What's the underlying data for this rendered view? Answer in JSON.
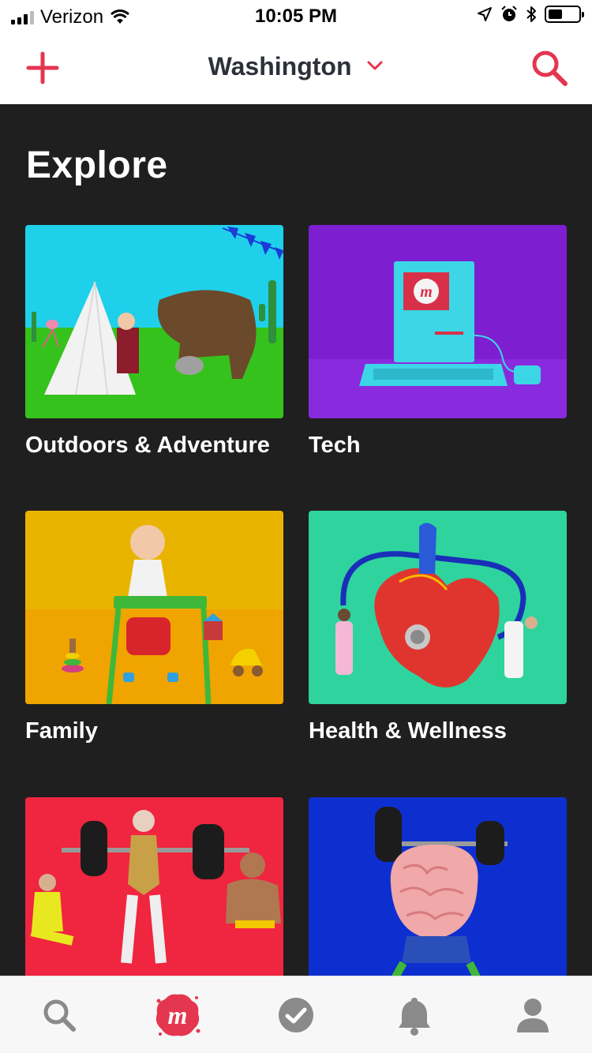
{
  "status_bar": {
    "carrier": "Verizon",
    "time": "10:05 PM"
  },
  "nav": {
    "location": "Washington",
    "accent_color": "#e5364f"
  },
  "explore": {
    "title": "Explore",
    "categories": [
      {
        "label": "Outdoors & Adventure",
        "bg_color": "#1fd0ea"
      },
      {
        "label": "Tech",
        "bg_color": "#7d1fd0"
      },
      {
        "label": "Family",
        "bg_color": "#f0a400"
      },
      {
        "label": "Health & Wellness",
        "bg_color": "#2fd39e"
      },
      {
        "label": "",
        "bg_color": "#f0253f"
      },
      {
        "label": "",
        "bg_color": "#0e2fcf"
      }
    ]
  },
  "tab_bar": {
    "tabs": [
      "search-tab",
      "home-tab",
      "calendar-tab",
      "notifications-tab",
      "profile-tab"
    ],
    "icon_color": "#8a8a8a"
  }
}
